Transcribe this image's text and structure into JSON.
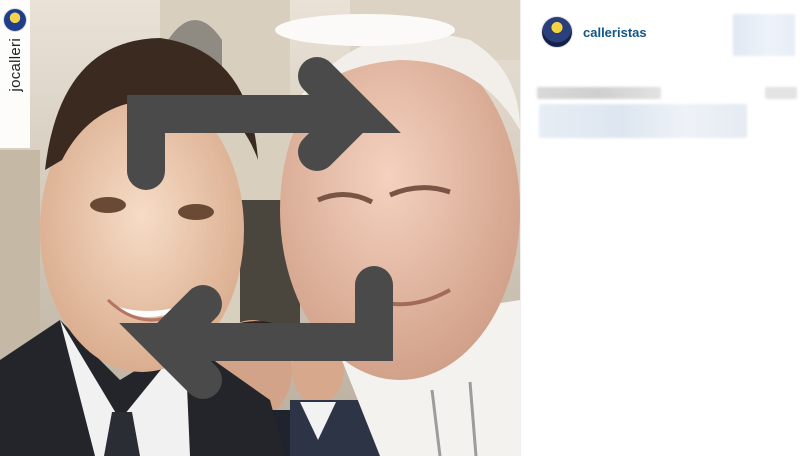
{
  "repost": {
    "username": "jocalleri",
    "icon": "repost-icon"
  },
  "post": {
    "username": "calleristas",
    "avatar_icon": "user-avatar"
  },
  "colors": {
    "username_link": "#125688",
    "pane_background": "#ffffff"
  }
}
